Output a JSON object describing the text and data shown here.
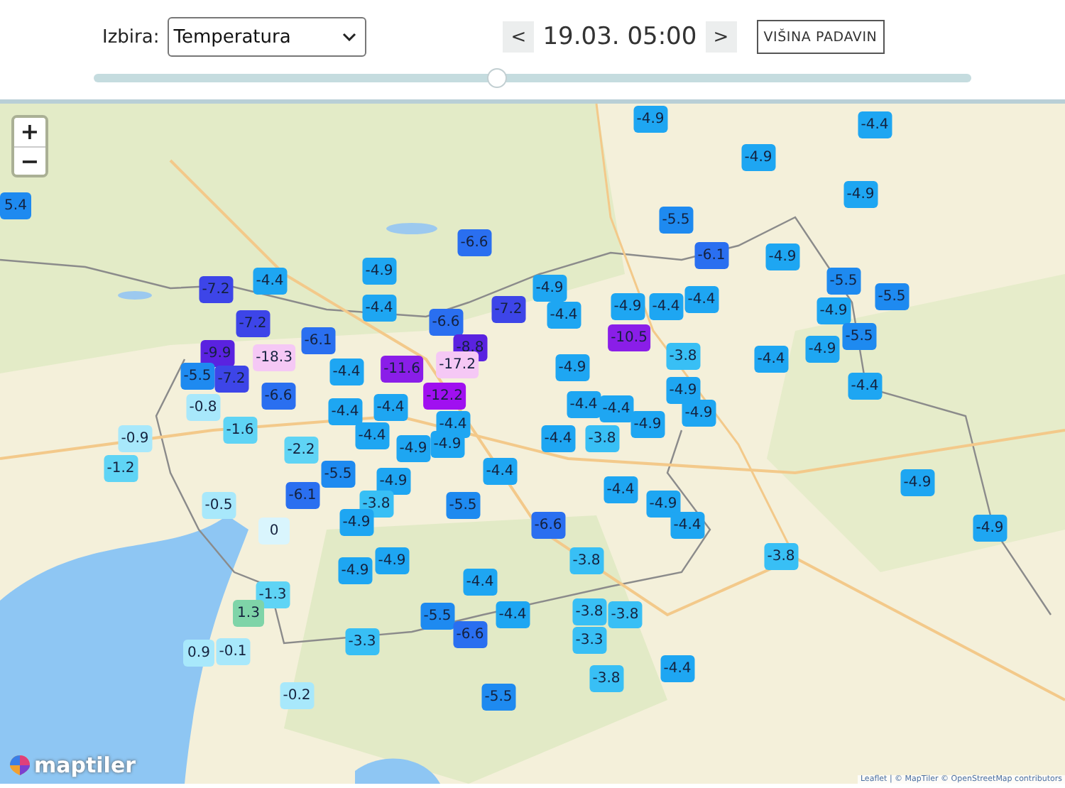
{
  "controls": {
    "select_label": "Izbira:",
    "select_value": "Temperatura",
    "prev": "<",
    "time": "19.03. 05:00",
    "next": ">",
    "layer_button": "VIŠINA PADAVIN",
    "slider": {
      "level": 0.46
    }
  },
  "map": {
    "zoom_in": "+",
    "zoom_out": "−",
    "logo": "maptiler",
    "attribution": "Leaflet | © MapTiler © OpenStreetMap contributors",
    "markers": [
      {
        "value": "-4.9",
        "color": "#1ea6f2"
      },
      {
        "value": "-4.4",
        "color": "#1ea6f2"
      },
      {
        "value": "-4.9",
        "color": "#1ea6f2"
      },
      {
        "value": "-4.9",
        "color": "#1ea6f2"
      },
      {
        "value": "5.4",
        "color": "#1e8af0"
      },
      {
        "value": "-5.5",
        "color": "#1e8af0"
      },
      {
        "value": "-6.6",
        "color": "#2a6ff0"
      },
      {
        "value": "-6.1",
        "color": "#2a6ff0"
      },
      {
        "value": "-4.9",
        "color": "#1ea6f2"
      },
      {
        "value": "-4.9",
        "color": "#1ea6f2"
      },
      {
        "value": "-7.2",
        "color": "#3d45e8"
      },
      {
        "value": "-4.4",
        "color": "#1ea6f2"
      },
      {
        "value": "-4.9",
        "color": "#1ea6f2"
      },
      {
        "value": "-5.5",
        "color": "#1e8af0"
      },
      {
        "value": "-5.5",
        "color": "#1e8af0"
      },
      {
        "value": "-4.4",
        "color": "#1ea6f2"
      },
      {
        "value": "-7.2",
        "color": "#3d45e8"
      },
      {
        "value": "-4.4",
        "color": "#1ea6f2"
      },
      {
        "value": "-4.9",
        "color": "#1ea6f2"
      },
      {
        "value": "-4.4",
        "color": "#1ea6f2"
      },
      {
        "value": "-4.4",
        "color": "#1ea6f2"
      },
      {
        "value": "-4.9",
        "color": "#1ea6f2"
      },
      {
        "value": "-7.2",
        "color": "#3d45e8"
      },
      {
        "value": "-6.6",
        "color": "#2a6ff0"
      },
      {
        "value": "-6.1",
        "color": "#2a6ff0"
      },
      {
        "value": "-8.8",
        "color": "#5a22e0"
      },
      {
        "value": "-10.5",
        "color": "#8a1ee8"
      },
      {
        "value": "-4.9",
        "color": "#1ea6f2"
      },
      {
        "value": "-5.5",
        "color": "#1e8af0"
      },
      {
        "value": "-9.9",
        "color": "#5a22e0"
      },
      {
        "value": "-18.3",
        "color": "#f5c8f5"
      },
      {
        "value": "-4.4",
        "color": "#1ea6f2"
      },
      {
        "value": "-11.6",
        "color": "#8a1ee8"
      },
      {
        "value": "-17.2",
        "color": "#f5c8f5"
      },
      {
        "value": "-4.9",
        "color": "#1ea6f2"
      },
      {
        "value": "-3.8",
        "color": "#38bff5"
      },
      {
        "value": "-4.4",
        "color": "#1ea6f2"
      },
      {
        "value": "-5.5",
        "color": "#1e8af0"
      },
      {
        "value": "-7.2",
        "color": "#3d45e8"
      },
      {
        "value": "-6.6",
        "color": "#2a6ff0"
      },
      {
        "value": "-12.2",
        "color": "#a010f0"
      },
      {
        "value": "-4.9",
        "color": "#1ea6f2"
      },
      {
        "value": "-4.4",
        "color": "#1ea6f2"
      },
      {
        "value": "-0.8",
        "color": "#a8e8fb"
      },
      {
        "value": "-4.4",
        "color": "#1ea6f2"
      },
      {
        "value": "-4.4",
        "color": "#1ea6f2"
      },
      {
        "value": "-4.4",
        "color": "#1ea6f2"
      },
      {
        "value": "-4.4",
        "color": "#1ea6f2"
      },
      {
        "value": "-4.9",
        "color": "#1ea6f2"
      },
      {
        "value": "-0.9",
        "color": "#a8e8fb"
      },
      {
        "value": "-1.6",
        "color": "#5fd4f5"
      },
      {
        "value": "-4.4",
        "color": "#1ea6f2"
      },
      {
        "value": "-4.4",
        "color": "#1ea6f2"
      },
      {
        "value": "-4.4",
        "color": "#1ea6f2"
      },
      {
        "value": "-3.8",
        "color": "#38bff5"
      },
      {
        "value": "-4.9",
        "color": "#1ea6f2"
      },
      {
        "value": "-2.2",
        "color": "#5fd4f5"
      },
      {
        "value": "-4.9",
        "color": "#1ea6f2"
      },
      {
        "value": "-4.9",
        "color": "#1ea6f2"
      },
      {
        "value": "-1.2",
        "color": "#5fd4f5"
      },
      {
        "value": "-5.5",
        "color": "#1e8af0"
      },
      {
        "value": "-4.4",
        "color": "#1ea6f2"
      },
      {
        "value": "-6.1",
        "color": "#2a6ff0"
      },
      {
        "value": "-4.9",
        "color": "#1ea6f2"
      },
      {
        "value": "-4.4",
        "color": "#1ea6f2"
      },
      {
        "value": "-4.9",
        "color": "#1ea6f2"
      },
      {
        "value": "-0.5",
        "color": "#a8e8fb"
      },
      {
        "value": "-3.8",
        "color": "#38bff5"
      },
      {
        "value": "-5.5",
        "color": "#1e8af0"
      },
      {
        "value": "-4.9",
        "color": "#1ea6f2"
      },
      {
        "value": "0",
        "color": "#d9f5fd"
      },
      {
        "value": "-4.9",
        "color": "#1ea6f2"
      },
      {
        "value": "-6.6",
        "color": "#2a6ff0"
      },
      {
        "value": "-4.4",
        "color": "#1ea6f2"
      },
      {
        "value": "-4.9",
        "color": "#1ea6f2"
      },
      {
        "value": "-4.9",
        "color": "#1ea6f2"
      },
      {
        "value": "-3.8",
        "color": "#38bff5"
      },
      {
        "value": "-3.8",
        "color": "#38bff5"
      },
      {
        "value": "-4.9",
        "color": "#1ea6f2"
      },
      {
        "value": "-4.4",
        "color": "#1ea6f2"
      },
      {
        "value": "-1.3",
        "color": "#5fd4f5"
      },
      {
        "value": "1.3",
        "color": "#7fd4a8"
      },
      {
        "value": "-5.5",
        "color": "#1e8af0"
      },
      {
        "value": "-4.4",
        "color": "#1ea6f2"
      },
      {
        "value": "-3.8",
        "color": "#38bff5"
      },
      {
        "value": "-3.8",
        "color": "#38bff5"
      },
      {
        "value": "-3.3",
        "color": "#38bff5"
      },
      {
        "value": "-6.6",
        "color": "#2a6ff0"
      },
      {
        "value": "-3.3",
        "color": "#38bff5"
      },
      {
        "value": "0.9",
        "color": "#a8e8fb"
      },
      {
        "value": "-0.1",
        "color": "#a8e8fb"
      },
      {
        "value": "-4.4",
        "color": "#1ea6f2"
      },
      {
        "value": "-3.8",
        "color": "#38bff5"
      },
      {
        "value": "-0.2",
        "color": "#a8e8fb"
      },
      {
        "value": "-5.5",
        "color": "#1e8af0"
      }
    ]
  }
}
